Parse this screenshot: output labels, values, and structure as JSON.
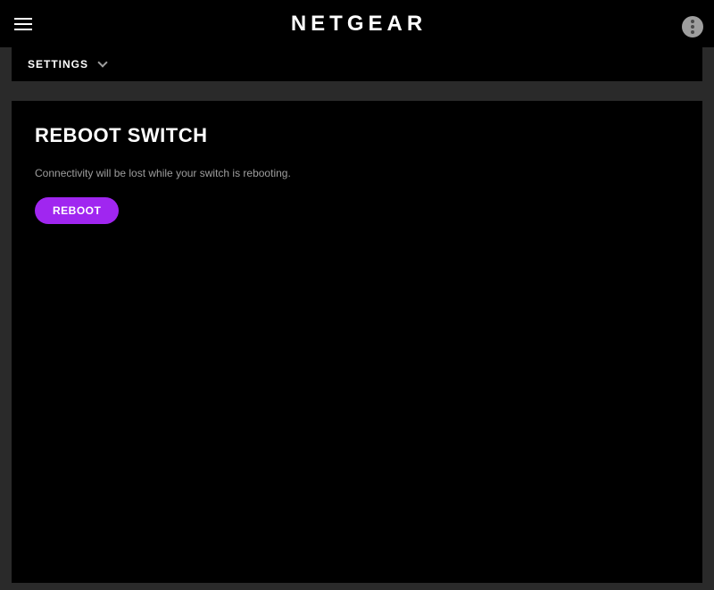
{
  "header": {
    "brand": "NETGEAR"
  },
  "breadcrumb": {
    "label": "SETTINGS"
  },
  "panel": {
    "title": "REBOOT SWITCH",
    "description": "Connectivity will be lost while your switch is rebooting.",
    "action_label": "REBOOT"
  }
}
